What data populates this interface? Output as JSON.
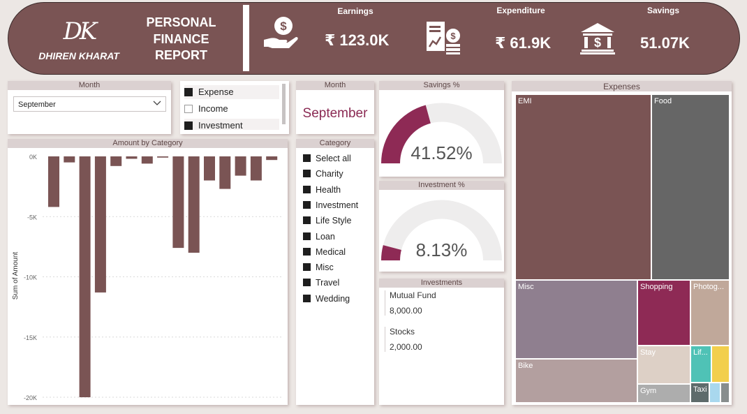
{
  "header": {
    "logo_mark": "DK",
    "logo_name": "DHIREN KHARAT",
    "title_lines": [
      "PERSONAL",
      "FINANCE",
      "REPORT"
    ],
    "kpis": [
      {
        "label": "Earnings",
        "value": "₹ 123.0K",
        "icon": "money-hand-icon"
      },
      {
        "label": "Expenditure",
        "value": "₹ 61.9K",
        "icon": "bill-coins-icon"
      },
      {
        "label": "Savings",
        "value": "51.07K",
        "icon": "bank-icon"
      }
    ]
  },
  "month_slicer": {
    "title": "Month",
    "selected": "September"
  },
  "type_slicer": {
    "items": [
      {
        "label": "Expense",
        "checked": true
      },
      {
        "label": "Income",
        "checked": false
      },
      {
        "label": "Investment",
        "checked": true
      }
    ]
  },
  "month_card": {
    "title": "Month",
    "value": "September"
  },
  "category_slicer": {
    "title": "Category",
    "items": [
      {
        "label": "Select all",
        "checked": true
      },
      {
        "label": "Charity",
        "checked": true
      },
      {
        "label": "Health",
        "checked": true
      },
      {
        "label": "Investment",
        "checked": true
      },
      {
        "label": "Life Style",
        "checked": true
      },
      {
        "label": "Loan",
        "checked": true
      },
      {
        "label": "Medical",
        "checked": true
      },
      {
        "label": "Misc",
        "checked": true
      },
      {
        "label": "Travel",
        "checked": true
      },
      {
        "label": "Wedding",
        "checked": true
      }
    ]
  },
  "savings_gauge": {
    "title": "Savings %",
    "value": "41.52%",
    "percent": 41.52,
    "color": "#8e2a55"
  },
  "investment_gauge": {
    "title": "Investment %",
    "value": "8.13%",
    "percent": 8.13,
    "color": "#8e2a55"
  },
  "investments": {
    "title": "Investments",
    "items": [
      {
        "label": "Mutual Fund",
        "value": "8,000.00"
      },
      {
        "label": "Stocks",
        "value": "2,000.00"
      }
    ]
  },
  "chart_data": {
    "type": "bar",
    "title": "Amount by Category",
    "ylabel": "Sum of Amount",
    "xlabel": "",
    "ylim": [
      -20000,
      0
    ],
    "yticks": [
      0,
      -5000,
      -10000,
      -15000,
      -20000
    ],
    "ytick_labels": [
      "0K",
      "-5K",
      "-10K",
      "-15K",
      "-20K"
    ],
    "values": [
      -4200,
      -500,
      -20000,
      -11300,
      -800,
      -200,
      -600,
      -100,
      -7600,
      -8000,
      -2000,
      -2700,
      -1600,
      -2000,
      -300
    ],
    "color": "#7a5454"
  },
  "treemap": {
    "title": "Expenses",
    "cells": [
      {
        "label": "EMI",
        "color": "#7a5454"
      },
      {
        "label": "Food",
        "color": "#666666"
      },
      {
        "label": "Misc",
        "color": "#8f7f8f"
      },
      {
        "label": "Shopping",
        "color": "#8e2a55"
      },
      {
        "label": "Photog...",
        "color": "#c0a89a"
      },
      {
        "label": "Stay",
        "color": "#ddd0c6"
      },
      {
        "label": "Lif...",
        "color": "#4fc2b6"
      },
      {
        "label": "",
        "color": "#f2cf4d"
      },
      {
        "label": "Bike",
        "color": "#b39f9f"
      },
      {
        "label": "Gym",
        "color": "#adadad"
      },
      {
        "label": "Taxi",
        "color": "#5e6b6b"
      },
      {
        "label": "",
        "color": "#a9d8ee"
      },
      {
        "label": "",
        "color": "#888e8e"
      }
    ]
  }
}
